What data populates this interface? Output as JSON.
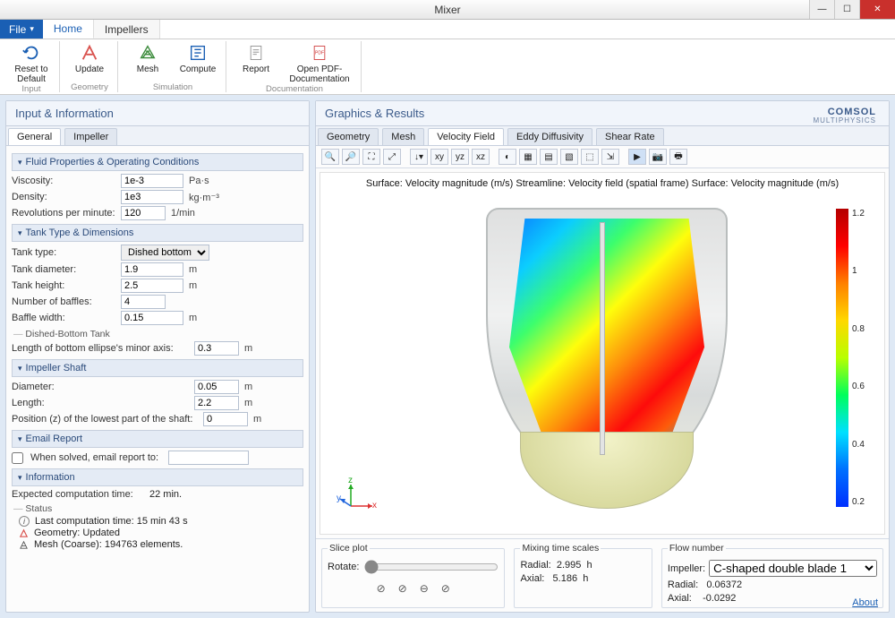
{
  "window": {
    "title": "Mixer"
  },
  "menubar": {
    "file": "File",
    "tabs": [
      "Home",
      "Impellers"
    ],
    "active": 0
  },
  "ribbon": {
    "groups": [
      {
        "label": "Input",
        "items": [
          {
            "name": "reset",
            "label": "Reset to\nDefault"
          }
        ]
      },
      {
        "label": "Geometry",
        "items": [
          {
            "name": "update",
            "label": "Update"
          }
        ]
      },
      {
        "label": "Simulation",
        "items": [
          {
            "name": "mesh",
            "label": "Mesh"
          },
          {
            "name": "compute",
            "label": "Compute"
          }
        ]
      },
      {
        "label": "Documentation",
        "items": [
          {
            "name": "report",
            "label": "Report"
          },
          {
            "name": "openpdf",
            "label": "Open PDF-\nDocumentation"
          }
        ]
      }
    ]
  },
  "left": {
    "header": "Input & Information",
    "tabs": [
      "General",
      "Impeller"
    ],
    "activeTab": 0,
    "fluid": {
      "title": "Fluid Properties & Operating Conditions",
      "viscosity": {
        "label": "Viscosity:",
        "value": "1e-3",
        "unit": "Pa·s"
      },
      "density": {
        "label": "Density:",
        "value": "1e3",
        "unit": "kg·m⁻³"
      },
      "rpm": {
        "label": "Revolutions per minute:",
        "value": "120",
        "unit": "1/min"
      }
    },
    "tank": {
      "title": "Tank Type & Dimensions",
      "type": {
        "label": "Tank type:",
        "value": "Dished bottom"
      },
      "diameter": {
        "label": "Tank diameter:",
        "value": "1.9",
        "unit": "m"
      },
      "height": {
        "label": "Tank height:",
        "value": "2.5",
        "unit": "m"
      },
      "baffles": {
        "label": "Number of baffles:",
        "value": "4"
      },
      "bafflewidth": {
        "label": "Baffle width:",
        "value": "0.15",
        "unit": "m"
      },
      "dishedSub": "Dished-Bottom Tank",
      "minoraxis": {
        "label": "Length of bottom ellipse's minor axis:",
        "value": "0.3",
        "unit": "m"
      }
    },
    "shaft": {
      "title": "Impeller Shaft",
      "diameter": {
        "label": "Diameter:",
        "value": "0.05",
        "unit": "m"
      },
      "length": {
        "label": "Length:",
        "value": "2.2",
        "unit": "m"
      },
      "posz": {
        "label": "Position (z) of the lowest part of the shaft:",
        "value": "0",
        "unit": "m"
      }
    },
    "email": {
      "title": "Email Report",
      "check": "When solved, email report to:",
      "value": ""
    },
    "info": {
      "title": "Information",
      "expected": {
        "label": "Expected computation time:",
        "value": "22 min."
      },
      "statusSub": "Status",
      "lastrun": "Last computation time: 15 min 43 s",
      "geom": "Geometry: Updated",
      "mesh": "Mesh (Coarse): 194763 elements."
    }
  },
  "right": {
    "header": "Graphics & Results",
    "tabs": [
      "Geometry",
      "Mesh",
      "Velocity Field",
      "Eddy Diffusivity",
      "Shear Rate"
    ],
    "activeTab": 2,
    "plotTitle": "Surface: Velocity magnitude (m/s)   Streamline: Velocity field (spatial frame)   Surface: Velocity magnitude (m/s)",
    "cb": [
      "1.2",
      "1",
      "0.8",
      "0.6",
      "0.4",
      "0.2"
    ],
    "axes": {
      "x": "x",
      "y": "y",
      "z": "z"
    },
    "slice": {
      "title": "Slice plot",
      "rotate": "Rotate:"
    },
    "mixing": {
      "title": "Mixing time scales",
      "radialL": "Radial:",
      "radialV": "2.995",
      "axialL": "Axial:",
      "axialV": "5.186",
      "unit": "h"
    },
    "flow": {
      "title": "Flow number",
      "impL": "Impeller:",
      "impV": "C-shaped double blade 1",
      "radialL": "Radial:",
      "radialV": "0.06372",
      "axialL": "Axial:",
      "axialV": "-0.0292"
    },
    "about": "About"
  },
  "logo": {
    "line1": "COMSOL",
    "line2": "MULTIPHYSICS"
  }
}
